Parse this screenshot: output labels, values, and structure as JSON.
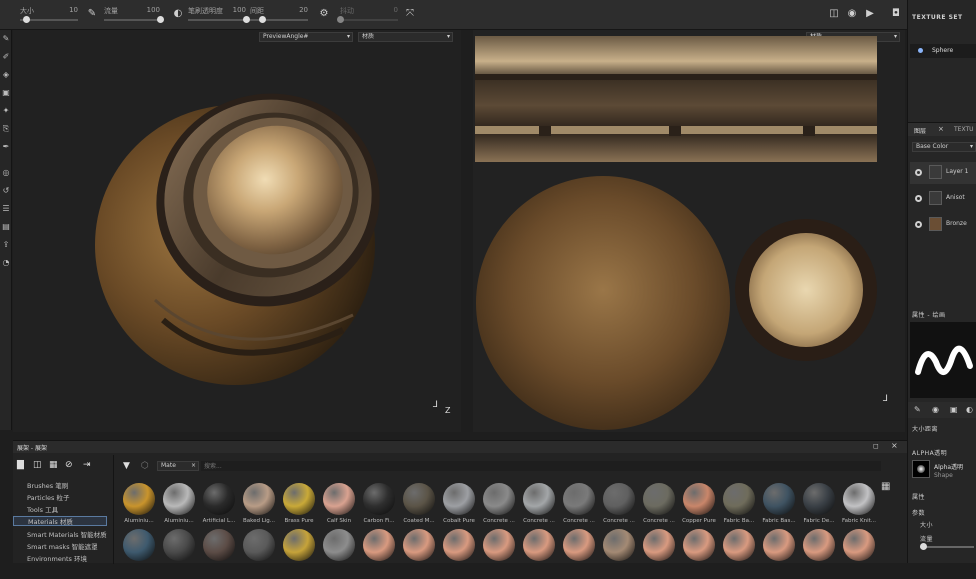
{
  "toolbar": {
    "sliders": [
      {
        "label": "大小",
        "value": "10",
        "fill": 0.1
      },
      {
        "label": "流量",
        "value": "100",
        "fill": 1.0
      },
      {
        "label": "笔刷透明度",
        "value": "100",
        "fill": 1.0
      },
      {
        "label": "间距",
        "value": "20",
        "fill": 0.2
      },
      {
        "label": "抖动",
        "value": "0",
        "fill": 0.0
      }
    ]
  },
  "viewport3d": {
    "display_dropdown": "PreviewAngle#",
    "channel_dropdown": "材质",
    "axis_label": "Z"
  },
  "viewport2d": {
    "channel_dropdown": "材质"
  },
  "texture_set": {
    "title": "TEXTURE SET",
    "item": "Sphere"
  },
  "layers": {
    "tab": "图层",
    "tab2": "TEXTU",
    "channel_dropdown": "Base Color",
    "items": [
      {
        "name": "Layer 1"
      },
      {
        "name": "Anisot"
      },
      {
        "name": "Bronze"
      }
    ]
  },
  "properties": {
    "title": "属性 - 绘画",
    "sub_title": "大小距离",
    "alpha_title": "ALPHA透明",
    "alpha_name": "Alpha透明",
    "alpha_type": "Shape",
    "section_props": "属性",
    "section_params": "参数",
    "param_size": "大小",
    "param_flow": "流量"
  },
  "shelf": {
    "title": "展架 - 展架",
    "search_dropdown": "Mate",
    "search_placeholder": "搜索...",
    "categories": [
      "Brushes 笔刷",
      "Particles 粒子",
      "Tools 工具",
      "Materials 材质",
      "Smart Materials 智能材质",
      "Smart masks 智能遮罩",
      "Environments 环境"
    ],
    "selected_category_index": 3,
    "materials_row1": [
      {
        "name": "Aluminiu...",
        "color": "#c9942c"
      },
      {
        "name": "Aluminiu...",
        "color": "#b9b9b9"
      },
      {
        "name": "Artificial L...",
        "color": "#2a2a2a"
      },
      {
        "name": "Baked Lig...",
        "color": "#b89c86"
      },
      {
        "name": "Brass Pure",
        "color": "#c9a938"
      },
      {
        "name": "Calf Skin",
        "color": "#d9a290"
      },
      {
        "name": "Carbon Fi...",
        "color": "#2e2e2e"
      },
      {
        "name": "Coated M...",
        "color": "#5b5447"
      },
      {
        "name": "Cobalt Pure",
        "color": "#9d9fa3"
      },
      {
        "name": "Concrete ...",
        "color": "#8a8a8a"
      },
      {
        "name": "Concrete ...",
        "color": "#a3a6a8"
      },
      {
        "name": "Concrete ...",
        "color": "#7a7a7a"
      },
      {
        "name": "Concrete ...",
        "color": "#606060"
      },
      {
        "name": "Concrete ...",
        "color": "#6c6b60"
      },
      {
        "name": "Copper Pure",
        "color": "#c9866a"
      },
      {
        "name": "Fabric Ba...",
        "color": "#6f6c5b"
      },
      {
        "name": "Fabric Bas...",
        "color": "#3f5362"
      },
      {
        "name": "Fabric De...",
        "color": "#3a4046"
      },
      {
        "name": "Fabric Knit...",
        "color": "#c2c2c4"
      }
    ],
    "materials_row2": [
      {
        "color": "#3e5a6e"
      },
      {
        "color": "#4a4a4a"
      },
      {
        "color": "#5c4c46"
      },
      {
        "color": "#5a5a5a"
      },
      {
        "color": "#c6a33a"
      },
      {
        "color": "#8d8d8d"
      },
      {
        "color": "#d99a80"
      },
      {
        "color": "#d99a80"
      },
      {
        "color": "#d99a80"
      },
      {
        "color": "#d99a80"
      },
      {
        "color": "#d99a80"
      },
      {
        "color": "#d99a80"
      },
      {
        "color": "#a48a74"
      },
      {
        "color": "#d99a80"
      },
      {
        "color": "#d99a80"
      },
      {
        "color": "#d99a80"
      },
      {
        "color": "#d99a80"
      },
      {
        "color": "#d99a80"
      },
      {
        "color": "#d99a80"
      }
    ]
  }
}
